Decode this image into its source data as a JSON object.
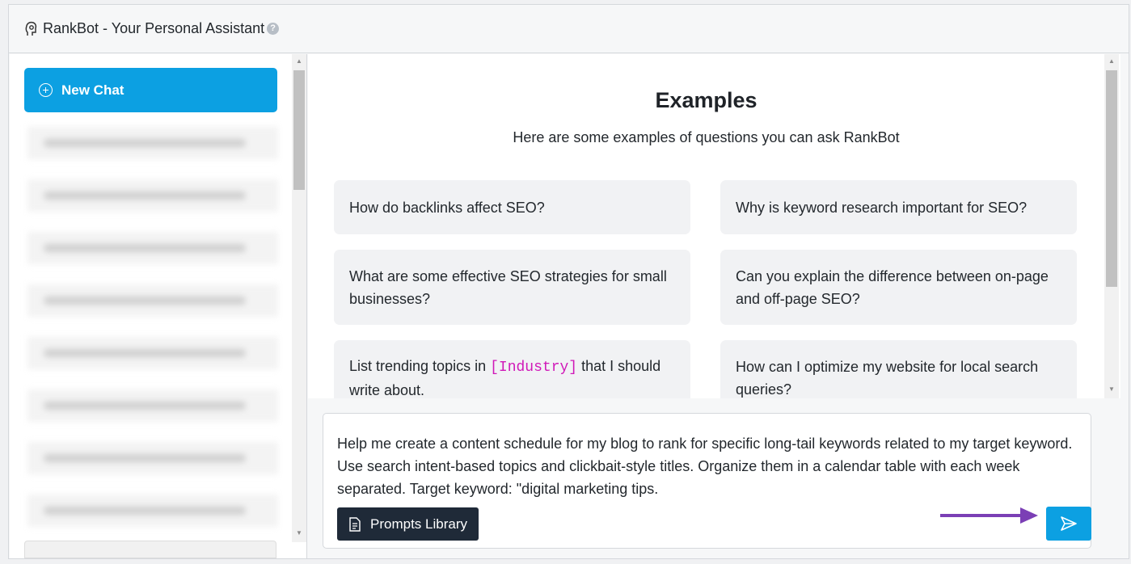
{
  "header": {
    "title": "RankBot - Your Personal Assistant",
    "help_icon": "?",
    "icon": "rankbot-logo-icon"
  },
  "sidebar": {
    "new_chat_label": "New Chat"
  },
  "examples": {
    "title": "Examples",
    "subtitle": "Here are some examples of questions you can ask RankBot",
    "items": [
      {
        "text": "How do backlinks affect SEO?"
      },
      {
        "text": "Why is keyword research important for SEO?"
      },
      {
        "text": "What are some effective SEO strategies for small businesses?"
      },
      {
        "text": "Can you explain the difference between on-page and off-page SEO?"
      },
      {
        "before": "List trending topics in ",
        "code": "[Industry]",
        "after": " that I should write about."
      },
      {
        "text": "How can I optimize my website for local search queries?"
      }
    ]
  },
  "input": {
    "value": "Help me create a content schedule for my blog to rank for specific long-tail keywords related to my target keyword. Use search intent-based topics and clickbait-style titles. Organize them in a calendar table with each week separated. Target keyword: \"digital marketing tips.",
    "prompts_library_label": "Prompts Library"
  },
  "colors": {
    "accent": "#0ca0e2",
    "dark_button": "#1f2a38",
    "annotation_arrow": "#7b3fb5",
    "code": "#d018b8"
  }
}
